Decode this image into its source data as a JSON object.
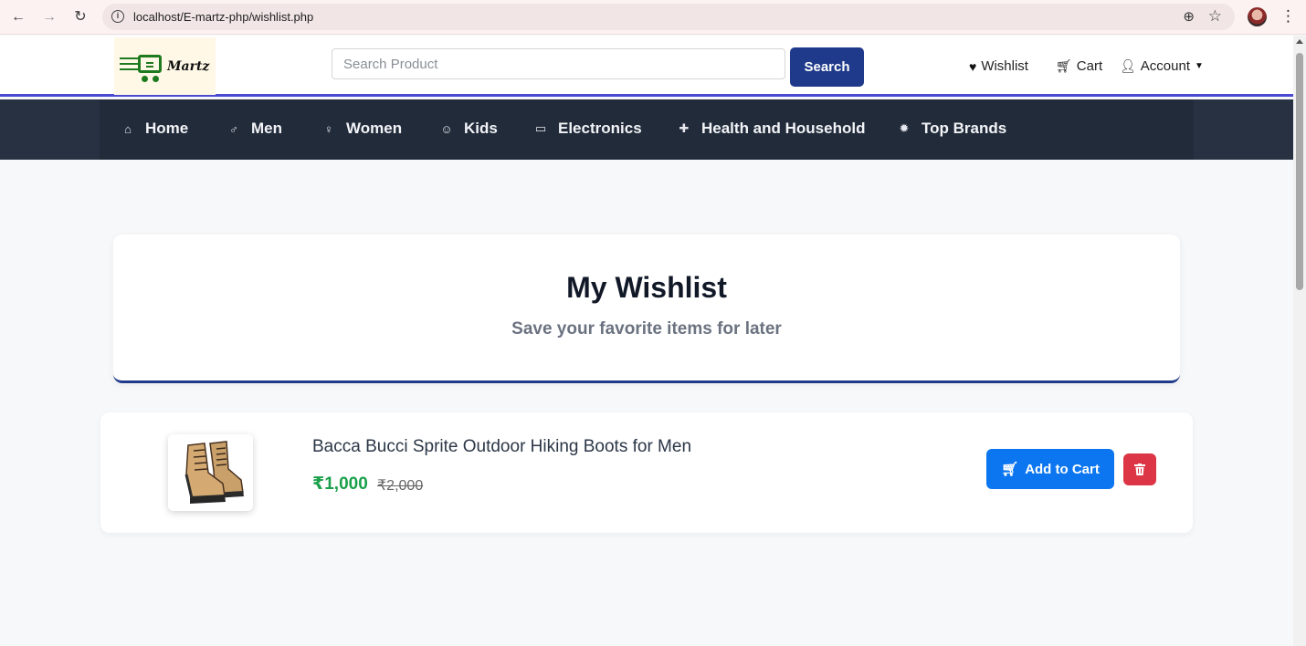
{
  "browser": {
    "back_icon": "arrow-left-icon",
    "forward_icon": "arrow-right-icon",
    "reload_icon": "reload-icon",
    "url": "localhost/E-martz-php/wishlist.php"
  },
  "header": {
    "logo_text": "Martz",
    "search": {
      "placeholder": "Search Product",
      "value": "",
      "button_label": "Search"
    },
    "links": {
      "wishlist": "Wishlist",
      "cart": "Cart",
      "account": "Account"
    }
  },
  "categories": [
    {
      "label": "Home",
      "icon": "home-icon"
    },
    {
      "label": "Men",
      "icon": "male-icon"
    },
    {
      "label": "Women",
      "icon": "female-icon"
    },
    {
      "label": "Kids",
      "icon": "child-icon"
    },
    {
      "label": "Electronics",
      "icon": "laptop-icon"
    },
    {
      "label": "Health and Household",
      "icon": "medkit-icon"
    },
    {
      "label": "Top Brands",
      "icon": "badge-icon"
    }
  ],
  "wishlist": {
    "title": "My Wishlist",
    "subtitle": "Save your favorite items for later",
    "items": [
      {
        "name": "Bacca Bucci Sprite Outdoor Hiking Boots for Men",
        "price": "₹1,000",
        "mrp": "₹2,000",
        "add_to_cart_label": "Add to Cart"
      }
    ]
  },
  "colors": {
    "primary_nav": "#222b3a",
    "search_button": "#1f3a8a",
    "add_to_cart": "#0b76ef",
    "delete": "#dc3545",
    "price": "#1aa04a"
  }
}
